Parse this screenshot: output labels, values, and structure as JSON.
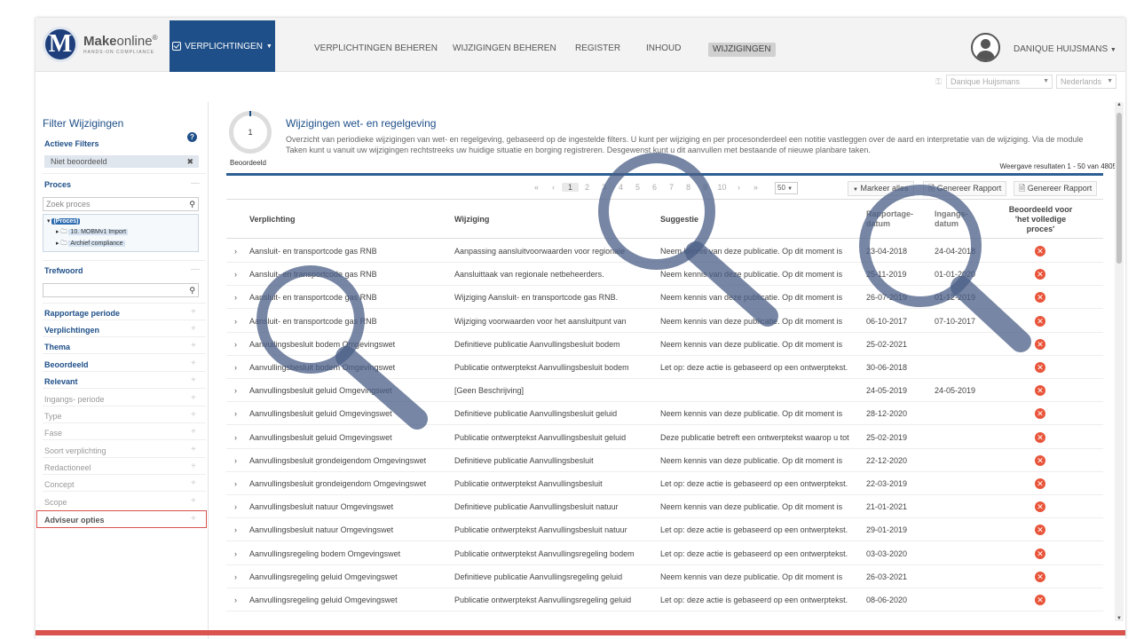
{
  "brand": {
    "name_bold": "Make",
    "name_light": "online",
    "mark": "M",
    "registered": "®",
    "tagline": "HANDS-ON COMPLIANCE"
  },
  "nav": {
    "primary": "VERPLICHTINGEN",
    "links": [
      "VERPLICHTINGEN BEHEREN",
      "WIJZIGINGEN BEHEREN",
      "REGISTER",
      "INHOUD"
    ],
    "active": "WIJZIGINGEN",
    "user": "DANIQUE HUIJSMANS"
  },
  "subbar": {
    "user_select": "Danique Huijsmans",
    "language_select": "Nederlands"
  },
  "sidebar": {
    "title": "Filter Wijzigingen",
    "active_filters_label": "Actieve Filters",
    "active_filter": "Niet beoordeeld",
    "proces_label": "Proces",
    "proces_search_placeholder": "Zoek proces",
    "tree": [
      "(Proces)",
      "10. MOBMv1 Import",
      "Archief compliance"
    ],
    "trefwoord_label": "Trefwoord",
    "sections_bold": [
      "Rapportage periode",
      "Verplichtingen",
      "Thema",
      "Beoordeeld",
      "Relevant"
    ],
    "sections_grey": [
      "Ingangs- periode",
      "Type",
      "Fase",
      "Soort verplichting",
      "Redactioneel",
      "Concept",
      "Scope"
    ],
    "adviseur": "Adviseur opties"
  },
  "main": {
    "donut_value": "1",
    "donut_label": "Beoordeeld",
    "title": "Wijzigingen wet- en regelgeving",
    "description": "Overzicht van periodieke wijzigingen van wet- en regelgeving, gebaseerd op de ingestelde filters. U kunt per wijziging en per procesonderdeel een notitie vastleggen over de aard en interpretatie van de wijziging. Via de module Taken kunt u vanuit uw wijzigingen rechtstreeks uw huidige situatie en borging registreren. Desgewenst kunt u dit aanvullen met bestaande of nieuwe planbare taken.",
    "result_count": "Weergave resultaten 1 - 50 van 4805",
    "pager": [
      "«",
      "‹",
      "1",
      "2",
      "3",
      "4",
      "5",
      "6",
      "7",
      "8",
      "9",
      "10",
      "›",
      "»"
    ],
    "page_size": "50",
    "buttons": {
      "mark_all": "Markeer alles",
      "report1": "Genereer Rapport",
      "report2": "Genereer Rapport"
    }
  },
  "table": {
    "headers": {
      "verplichting": "Verplichting",
      "wijziging": "Wijziging",
      "suggestie": "Suggestie",
      "rapportage": "Rapportage-\ndatum",
      "ingang": "Ingangs-\ndatum",
      "beoordeeld": "Beoordeeld voor\n'het volledige\nproces'"
    },
    "rows": [
      [
        "Aansluit- en transportcode gas RNB",
        "Aanpassing aansluitvoorwaarden voor regionale",
        "Neem kennis van deze publicatie. Op dit moment is",
        "23-04-2018",
        "24-04-2018"
      ],
      [
        "Aansluit- en transportcode gas RNB",
        "Aansluittaak van regionale netbeheerders.",
        "Neem kennis van deze publicatie. Op dit moment is",
        "25-11-2019",
        "01-01-2020"
      ],
      [
        "Aansluit- en transportcode gas RNB",
        "Wijziging Aansluit- en transportcode gas RNB.",
        "Neem kennis van deze publicatie. Op dit moment is",
        "26-07-2019",
        "01-12-2019"
      ],
      [
        "Aansluit- en transportcode gas RNB",
        "Wijziging voorwaarden voor het aansluitpunt van",
        "Neem kennis van deze publicatie. Op dit moment is",
        "06-10-2017",
        "07-10-2017"
      ],
      [
        "Aanvullingsbesluit bodem Omgevingswet",
        "Definitieve publicatie Aanvullingsbesluit bodem",
        "Neem kennis van deze publicatie. Op dit moment is",
        "25-02-2021",
        ""
      ],
      [
        "Aanvullingsbesluit bodem Omgevingswet",
        "Publicatie ontwerptekst Aanvullingsbesluit bodem",
        "Let op: deze actie is gebaseerd op een ontwerptekst.",
        "30-06-2018",
        ""
      ],
      [
        "Aanvullingsbesluit geluid Omgevingswet",
        "[Geen Beschrijving]",
        "",
        "24-05-2019",
        "24-05-2019"
      ],
      [
        "Aanvullingsbesluit geluid Omgevingswet",
        "Definitieve publicatie Aanvullingsbesluit geluid",
        "Neem kennis van deze publicatie. Op dit moment is",
        "28-12-2020",
        ""
      ],
      [
        "Aanvullingsbesluit geluid Omgevingswet",
        "Publicatie ontwerptekst Aanvullingsbesluit geluid",
        "Deze publicatie betreft een ontwerptekst waarop u tot",
        "25-02-2019",
        ""
      ],
      [
        "Aanvullingsbesluit grondeigendom Omgevingswet",
        "Definitieve publicatie Aanvullingsbesluit",
        "Neem kennis van deze publicatie. Op dit moment is",
        "22-12-2020",
        ""
      ],
      [
        "Aanvullingsbesluit grondeigendom Omgevingswet",
        "Publicatie ontwerptekst Aanvullingsbesluit",
        "Let op: deze actie is gebaseerd op een ontwerptekst.",
        "22-03-2019",
        ""
      ],
      [
        "Aanvullingsbesluit natuur Omgevingswet",
        "Definitieve publicatie Aanvullingsbesluit natuur",
        "Neem kennis van deze publicatie. Op dit moment is",
        "21-01-2021",
        ""
      ],
      [
        "Aanvullingsbesluit natuur Omgevingswet",
        "Publicatie ontwerptekst Aanvullingsbesluit natuur",
        "Let op: deze actie is gebaseerd op een ontwerptekst.",
        "29-01-2019",
        ""
      ],
      [
        "Aanvullingsregeling bodem Omgevingswet",
        "Publicatie ontwerptekst Aanvullingsregeling bodem",
        "Let op: deze actie is gebaseerd op een ontwerptekst.",
        "03-03-2020",
        ""
      ],
      [
        "Aanvullingsregeling geluid Omgevingswet",
        "Definitieve publicatie Aanvullingsregeling geluid",
        "Neem kennis van deze publicatie. Op dit moment is",
        "26-03-2021",
        ""
      ],
      [
        "Aanvullingsregeling geluid Omgevingswet",
        "Publicatie ontwerptekst Aanvullingsregeling geluid",
        "Let op: deze actie is gebaseerd op een ontwerptekst.",
        "08-06-2020",
        ""
      ]
    ]
  },
  "colors": {
    "brand_blue": "#1e4f88",
    "reject_red": "#e8553a",
    "overlay_magnifier": "#4a5d85"
  }
}
